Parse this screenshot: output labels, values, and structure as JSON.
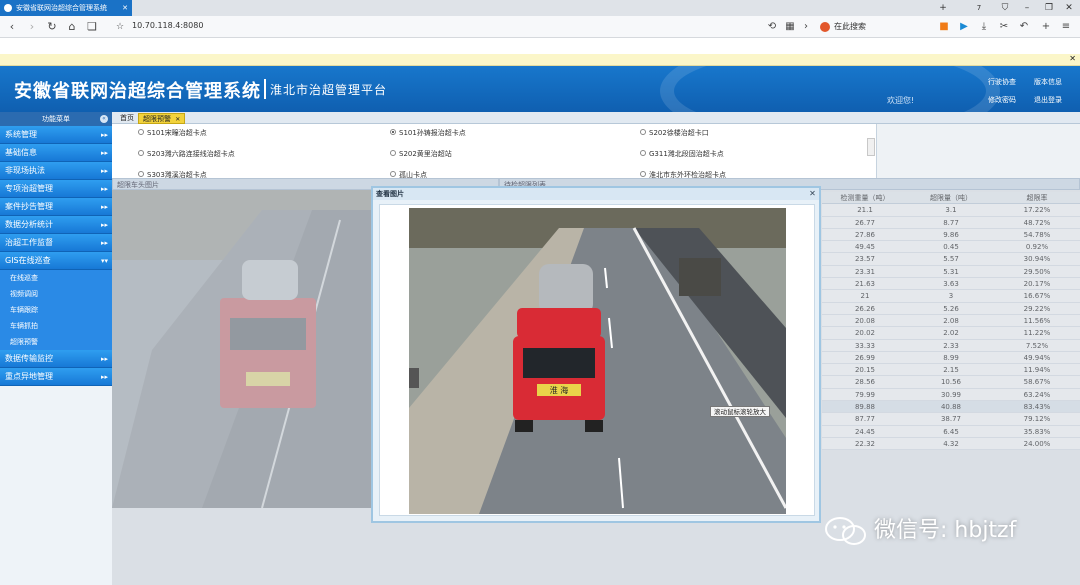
{
  "browser": {
    "tab_title": "安徽省联网治超综合管理系统",
    "url": "10.70.118.4:8080",
    "search_placeholder": "在此搜索",
    "tab_count": "7"
  },
  "header": {
    "title": "安徽省联网治超综合管理系统",
    "subtitle": "淮北市治超管理平台",
    "welcome": "欢迎您!",
    "links": [
      "行驶协查",
      "版本信息",
      "修改密码",
      "退出登录"
    ]
  },
  "sidebar": {
    "heading": "功能菜单",
    "items": [
      {
        "label": "系统管理"
      },
      {
        "label": "基础信息"
      },
      {
        "label": "非现场执法"
      },
      {
        "label": "专项治超管理"
      },
      {
        "label": "案件抄告管理"
      },
      {
        "label": "数据分析统计"
      },
      {
        "label": "治超工作监督"
      },
      {
        "label": "GIS在线巡查"
      }
    ],
    "subitems": [
      "在线巡查",
      "视频调阅",
      "车辆跟踪",
      "车辆抓拍",
      "超限预警"
    ],
    "items_after": [
      {
        "label": "数据传输监控"
      },
      {
        "label": "重点异地管理"
      }
    ]
  },
  "tabs": {
    "home": "首页",
    "active": "超限预警"
  },
  "stations": [
    {
      "label": "S101宋疃治超卡点",
      "selected": false
    },
    {
      "label": "S101孙铸报治超卡点",
      "selected": true
    },
    {
      "label": "S202徐楼治超卡口",
      "selected": false
    },
    {
      "label": "S203濉六路连接线治超卡点",
      "selected": false
    },
    {
      "label": "S202黄里治超站",
      "selected": false
    },
    {
      "label": "G311濉北段固治超卡点",
      "selected": false
    },
    {
      "label": "S303濉溪治超卡点",
      "selected": false
    },
    {
      "label": "孤山卡点",
      "selected": false
    },
    {
      "label": "淮北市东外环检治超卡点",
      "selected": false
    }
  ],
  "panels": {
    "left_title": "超限车头图片",
    "right_title": "待检超限列表"
  },
  "table": {
    "headers": [
      "检测重量（吨）",
      "超限量（吨）",
      "超限率"
    ],
    "rows": [
      [
        "21.1",
        "3.1",
        "17.22%"
      ],
      [
        "26.77",
        "8.77",
        "48.72%"
      ],
      [
        "27.86",
        "9.86",
        "54.78%"
      ],
      [
        "49.45",
        "0.45",
        "0.92%"
      ],
      [
        "23.57",
        "5.57",
        "30.94%"
      ],
      [
        "23.31",
        "5.31",
        "29.50%"
      ],
      [
        "21.63",
        "3.63",
        "20.17%"
      ],
      [
        "21",
        "3",
        "16.67%"
      ],
      [
        "26.26",
        "5.26",
        "29.22%"
      ],
      [
        "20.08",
        "2.08",
        "11.56%"
      ],
      [
        "20.02",
        "2.02",
        "11.22%"
      ],
      [
        "33.33",
        "2.33",
        "7.52%"
      ],
      [
        "26.99",
        "8.99",
        "49.94%"
      ],
      [
        "20.15",
        "2.15",
        "11.94%"
      ],
      [
        "28.56",
        "10.56",
        "58.67%"
      ],
      [
        "79.99",
        "30.99",
        "63.24%"
      ],
      [
        "89.88",
        "40.88",
        "83.43%"
      ],
      [
        "87.77",
        "38.77",
        "79.12%"
      ],
      [
        "24.45",
        "6.45",
        "35.83%"
      ],
      [
        "22.32",
        "4.32",
        "24.00%"
      ]
    ],
    "highlight_row": 16
  },
  "modal": {
    "title": "查看图片",
    "tooltip": "滚动鼠标滚轮放大",
    "plate_text": "淮 海"
  },
  "watermark": "微信号: hbjtzf",
  "colors": {
    "header_blue": "#1877cc",
    "menu_blue": "#1e88e5",
    "active_tab": "#f2d23b",
    "truck_red": "#d92b35"
  }
}
